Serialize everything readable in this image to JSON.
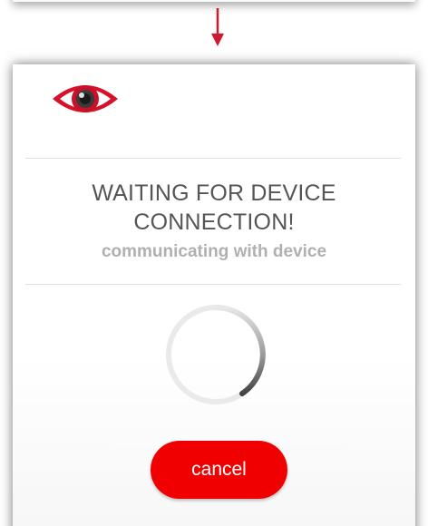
{
  "dialog": {
    "title": "WAITING FOR DEVICE CONNECTION!",
    "subtitle": "communicating with device",
    "logo_icon": "eye-icon",
    "cancel_label": "cancel"
  },
  "colors": {
    "accent": "#e8112d",
    "button": "#f00000",
    "title_text": "#555555",
    "subtitle_text": "#b0b0b0"
  }
}
